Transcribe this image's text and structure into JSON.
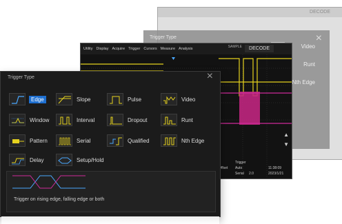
{
  "back_screen": {
    "decode": "DECODE"
  },
  "mid_screen": {
    "title": "Trigger Type",
    "items": [
      {
        "label": "Video"
      },
      {
        "label": "Runt"
      },
      {
        "label": "Nth Edge"
      }
    ]
  },
  "scope_screen": {
    "menu": [
      "Utility",
      "Display",
      "Acquire",
      "Trigger",
      "Cursors",
      "Measure",
      "Analysis"
    ],
    "status": "SAMPLE",
    "decode": "DECODE",
    "info_trigger": "Trigger",
    "info_auto": "Auto",
    "info_serial": "Serial",
    "info_time": "11:38:09",
    "info_date": "2023/1/21",
    "info_left": "Offset",
    "info_ch": "2.0"
  },
  "dialog": {
    "title": "Trigger Type",
    "description": "Trigger on rising edge, falling edge or both",
    "items": [
      {
        "label": "Edge",
        "icon": "edge-icon",
        "active": true
      },
      {
        "label": "Slope",
        "icon": "slope-icon"
      },
      {
        "label": "Pulse",
        "icon": "pulse-icon"
      },
      {
        "label": "Video",
        "icon": "video-icon"
      },
      {
        "label": "Window",
        "icon": "window-icon"
      },
      {
        "label": "Interval",
        "icon": "interval-icon"
      },
      {
        "label": "Dropout",
        "icon": "dropout-icon"
      },
      {
        "label": "Runt",
        "icon": "runt-icon"
      },
      {
        "label": "Pattern",
        "icon": "pattern-icon"
      },
      {
        "label": "Serial",
        "icon": "serial-icon"
      },
      {
        "label": "Qualified",
        "icon": "qualified-icon"
      },
      {
        "label": "Nth Edge",
        "icon": "nth-edge-icon"
      },
      {
        "label": "Delay",
        "icon": "delay-icon"
      },
      {
        "label": "Setup/Hold",
        "icon": "setup-hold-icon"
      }
    ]
  },
  "colors": {
    "accent": "#1e6fd0",
    "trace_yellow": "#e6d21e",
    "trace_magenta": "#d02a9a",
    "dialog_bg": "#1b1b1b"
  }
}
